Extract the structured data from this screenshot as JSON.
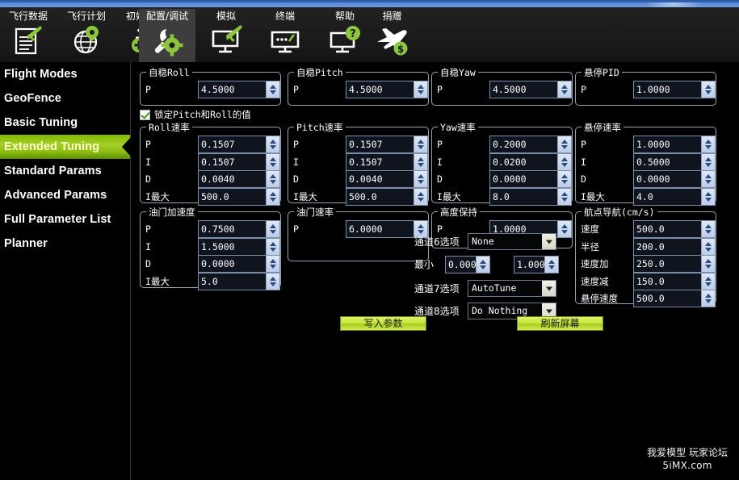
{
  "window": {
    "accent_blue": "#4a78c8",
    "accent_green": "#8ebe12"
  },
  "toolbar": {
    "tabs": [
      {
        "label": "飞行数据",
        "icon": "flight-data-icon",
        "active": false
      },
      {
        "label": "飞行计划",
        "icon": "flight-plan-globe-icon",
        "active": false
      },
      {
        "label": "初始设置",
        "icon": "initial-setup-gear-icon",
        "active": false
      },
      {
        "label": "配置/调试",
        "icon": "config-tuning-wrench-icon",
        "active": true
      },
      {
        "label": "模拟",
        "icon": "simulation-monitor-icon",
        "active": false
      },
      {
        "label": "终端",
        "icon": "terminal-monitor-icon",
        "active": false
      },
      {
        "label": "帮助",
        "icon": "help-monitor-icon",
        "active": false
      },
      {
        "label": "捐赠",
        "icon": "donate-plane-icon",
        "active": false
      }
    ]
  },
  "sidebar": {
    "items": [
      {
        "label": "Flight Modes",
        "selected": false
      },
      {
        "label": "GeoFence",
        "selected": false
      },
      {
        "label": "Basic Tuning",
        "selected": false
      },
      {
        "label": "Extended Tuning",
        "selected": true
      },
      {
        "label": "Standard Params",
        "selected": false
      },
      {
        "label": "Advanced Params",
        "selected": false
      },
      {
        "label": "Full Parameter List",
        "selected": false
      },
      {
        "label": "Planner",
        "selected": false
      }
    ]
  },
  "main": {
    "lock_checkbox": {
      "label": "锁定Pitch和Roll的值",
      "checked": true
    },
    "groups": {
      "stab_roll": {
        "legend": "自稳Roll",
        "rows": [
          {
            "label": "P",
            "value": "4.5000"
          }
        ]
      },
      "stab_pitch": {
        "legend": "自稳Pitch",
        "rows": [
          {
            "label": "P",
            "value": "4.5000"
          }
        ]
      },
      "stab_yaw": {
        "legend": "自稳Yaw",
        "rows": [
          {
            "label": "P",
            "value": "4.5000"
          }
        ]
      },
      "loiter_pid": {
        "legend": "悬停PID",
        "rows": [
          {
            "label": "P",
            "value": "1.0000"
          }
        ]
      },
      "rate_roll": {
        "legend": "Roll速率",
        "rows": [
          {
            "label": "P",
            "value": "0.1507"
          },
          {
            "label": "I",
            "value": "0.1507"
          },
          {
            "label": "D",
            "value": "0.0040"
          },
          {
            "label": "I最大",
            "value": "500.0"
          }
        ]
      },
      "rate_pitch": {
        "legend": "Pitch速率",
        "rows": [
          {
            "label": "P",
            "value": "0.1507"
          },
          {
            "label": "I",
            "value": "0.1507"
          },
          {
            "label": "D",
            "value": "0.0040"
          },
          {
            "label": "I最大",
            "value": "500.0"
          }
        ]
      },
      "rate_yaw": {
        "legend": "Yaw速率",
        "rows": [
          {
            "label": "P",
            "value": "0.2000"
          },
          {
            "label": "I",
            "value": "0.0200"
          },
          {
            "label": "D",
            "value": "0.0000"
          },
          {
            "label": "I最大",
            "value": "8.0"
          }
        ]
      },
      "loiter_rate": {
        "legend": "悬停速率",
        "rows": [
          {
            "label": "P",
            "value": "1.0000"
          },
          {
            "label": "I",
            "value": "0.5000"
          },
          {
            "label": "D",
            "value": "0.0000"
          },
          {
            "label": "I最大",
            "value": "4.0"
          }
        ]
      },
      "throttle_accel": {
        "legend": "油门加速度",
        "rows": [
          {
            "label": "P",
            "value": "0.7500"
          },
          {
            "label": "I",
            "value": "1.5000"
          },
          {
            "label": "D",
            "value": "0.0000"
          },
          {
            "label": "I最大",
            "value": "5.0"
          }
        ]
      },
      "throttle_rate": {
        "legend": "油门速率",
        "rows": [
          {
            "label": "P",
            "value": "6.0000"
          }
        ]
      },
      "alt_hold": {
        "legend": "高度保持",
        "rows": [
          {
            "label": "P",
            "value": "1.0000"
          }
        ]
      },
      "wp_nav": {
        "legend": "航点导航(cm/s)",
        "rows": [
          {
            "label": "速度",
            "value": "500.0"
          },
          {
            "label": "半径",
            "value": "200.0"
          },
          {
            "label": "速度加",
            "value": "250.0"
          },
          {
            "label": "速度减",
            "value": "150.0"
          },
          {
            "label": "悬停速度",
            "value": "500.0"
          }
        ]
      }
    },
    "channel_options": [
      {
        "label": "通道6选项",
        "value": "None"
      },
      {
        "label": "通道7选项",
        "value": "AutoTune"
      },
      {
        "label": "通道8选项",
        "value": "Do Nothing"
      }
    ],
    "min_row": {
      "label": "最小",
      "min_value": "0.000",
      "max_value": "1.000"
    },
    "buttons": {
      "write": "写入参数",
      "refresh": "刷新屏幕"
    }
  },
  "watermark": {
    "line1": "我爱模型 玩家论坛",
    "line2": "5iMX.com"
  }
}
